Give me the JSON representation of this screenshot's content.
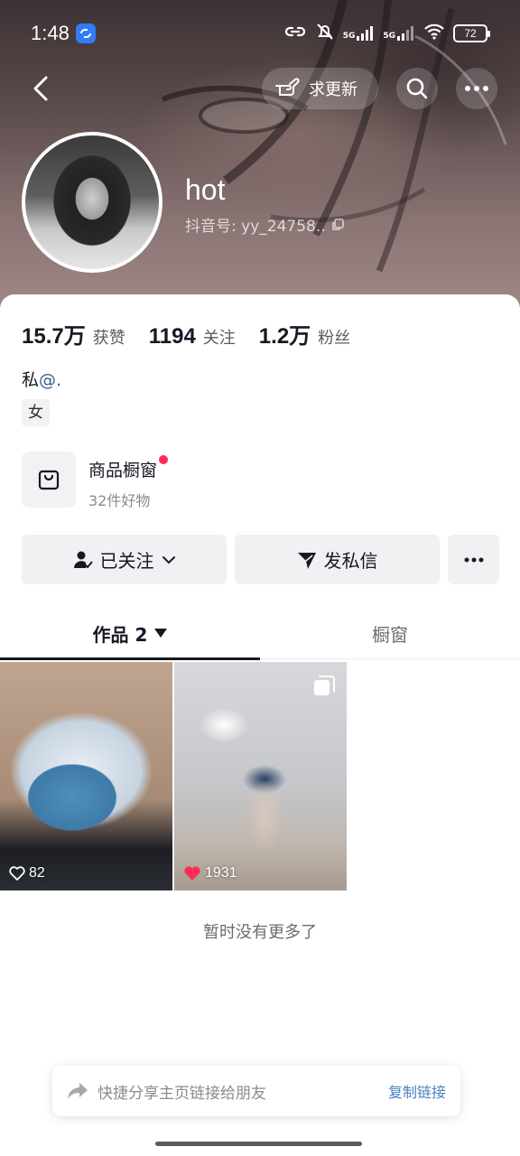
{
  "status_bar": {
    "time": "1:48",
    "signal_1": "5G",
    "signal_2": "5G",
    "battery": "72"
  },
  "nav": {
    "request_update_label": "求更新"
  },
  "profile": {
    "username": "hot",
    "douyin_id": "抖音号: yy_24758..",
    "bio_prefix": "私",
    "bio_at": "@.",
    "gender_tag": "女"
  },
  "stats": [
    {
      "value": "15.7万",
      "label": "获赞"
    },
    {
      "value": "1194",
      "label": "关注"
    },
    {
      "value": "1.2万",
      "label": "粉丝"
    }
  ],
  "shop": {
    "title": "商品橱窗",
    "subtitle": "32件好物"
  },
  "actions": {
    "followed_label": "已关注",
    "message_label": "发私信"
  },
  "tabs": {
    "works_label": "作品 2",
    "showcase_label": "橱窗"
  },
  "videos": [
    {
      "likes": "82",
      "liked": false
    },
    {
      "likes": "1931",
      "liked": true
    }
  ],
  "footer": {
    "no_more": "暂时没有更多了",
    "share_text": "快捷分享主页链接给朋友",
    "copy_link": "复制链接"
  },
  "colors": {
    "accent_red": "#fe2c55",
    "link_blue": "#4a7fc1"
  }
}
